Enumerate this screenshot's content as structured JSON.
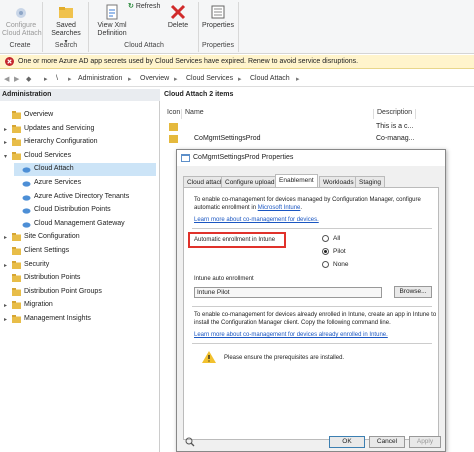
{
  "ribbon": {
    "configure_label": "Configure\nCloud Attach",
    "saved_searches_label": "Saved\nSearches",
    "refresh_label": "Refresh",
    "view_xml_label": "View Xml\nDefinition",
    "delete_label": "Delete",
    "properties_label": "Properties",
    "groups": {
      "create": "Create",
      "search": "Search",
      "cloud_attach": "Cloud Attach",
      "properties": "Properties"
    }
  },
  "notification": {
    "text": "One or more Azure AD app secrets used by Cloud Services have expired. Renew to avoid service disruptions."
  },
  "breadcrumb": [
    "\\",
    "Administration",
    "Overview",
    "Cloud Services",
    "Cloud Attach"
  ],
  "tree": {
    "header": "Administration",
    "items": [
      {
        "label": "Overview",
        "indent": 0,
        "expand": ""
      },
      {
        "label": "Updates and Servicing",
        "indent": 0,
        "expand": "▸"
      },
      {
        "label": "Hierarchy Configuration",
        "indent": 0,
        "expand": "▸"
      },
      {
        "label": "Cloud Services",
        "indent": 0,
        "expand": "▾"
      },
      {
        "label": "Cloud Attach",
        "indent": 1,
        "expand": "",
        "selected": true
      },
      {
        "label": "Azure Services",
        "indent": 1,
        "expand": ""
      },
      {
        "label": "Azure Active Directory Tenants",
        "indent": 1,
        "expand": ""
      },
      {
        "label": "Cloud Distribution Points",
        "indent": 1,
        "expand": ""
      },
      {
        "label": "Cloud Management Gateway",
        "indent": 1,
        "expand": ""
      },
      {
        "label": "Site Configuration",
        "indent": 0,
        "expand": "▸"
      },
      {
        "label": "Client Settings",
        "indent": 0,
        "expand": ""
      },
      {
        "label": "Security",
        "indent": 0,
        "expand": "▸"
      },
      {
        "label": "Distribution Points",
        "indent": 0,
        "expand": ""
      },
      {
        "label": "Distribution Point Groups",
        "indent": 0,
        "expand": ""
      },
      {
        "label": "Migration",
        "indent": 0,
        "expand": "▸"
      },
      {
        "label": "Management Insights",
        "indent": 0,
        "expand": "▸"
      }
    ]
  },
  "list": {
    "title": "Cloud Attach 2 items",
    "columns": [
      "Icon",
      "Name",
      "Description"
    ],
    "rows": [
      {
        "name": "",
        "description": "This is a c..."
      },
      {
        "name": "CoMgmtSettingsProd",
        "description": "Co-manag..."
      }
    ]
  },
  "dialog": {
    "title": "CoMgmtSettingsProd Properties",
    "tabs": [
      "Cloud attach",
      "Configure upload",
      "Enablement",
      "Workloads",
      "Staging"
    ],
    "active_tab": 2,
    "intro_line1": "To enable co-management for devices managed by Configuration Manager, configure",
    "intro_line2_prefix": "automatic enrollment in ",
    "intro_link": "Microsoft Intune",
    "intro_line2_suffix": ".",
    "learn_more_1": "Learn more about co-management for devices.",
    "auto_enroll_label": "Automatic enrollment in Intune",
    "radio_all": "All",
    "radio_pilot": "Pilot",
    "radio_none": "None",
    "selected_radio": "Pilot",
    "intune_auto_label": "Intune auto enrollment",
    "intune_auto_value": "Intune Pilot",
    "browse_label": "Browse...",
    "para2_line1": "To enable co-management for devices already enrolled in Intune, create an app in Intune to",
    "para2_line2": "install the Configuration Manager client. Copy the following command line.",
    "learn_more_2": "Learn more about co-management for devices already enrolled in Intune.",
    "warning_text": "Please ensure the prerequisites are installed.",
    "ok_label": "OK",
    "cancel_label": "Cancel",
    "apply_label": "Apply"
  },
  "colors": {
    "highlight_box": "#e0322b",
    "selection": "#cce4f7",
    "link": "#1a56c2",
    "notify_bg": "#fff4cc"
  }
}
